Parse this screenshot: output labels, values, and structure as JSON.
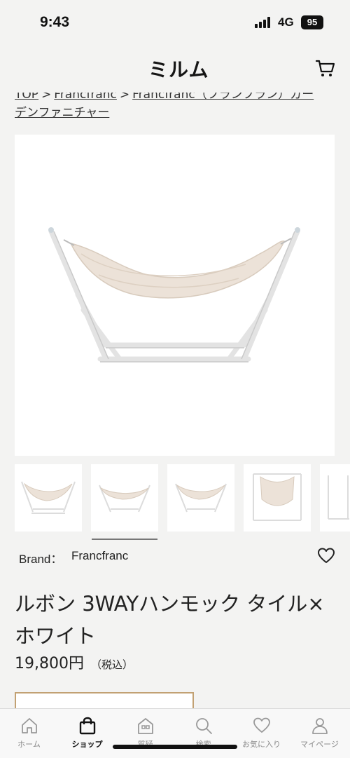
{
  "status": {
    "time": "9:43",
    "network": "4G",
    "battery": "95"
  },
  "header": {
    "logo": "ミルム",
    "cart_icon": "cart-icon"
  },
  "breadcrumb": {
    "items": [
      "TOP",
      "Francfranc",
      "Francfranc（フランフラン）ガーデンファニチャー"
    ],
    "line1": "Francfranc（フランフラン）ガー",
    "line2": "デンファニチャー"
  },
  "product": {
    "brand_label": "Brand：",
    "brand_name": "Francfranc",
    "title": "ルボン 3WAYハンモック タイル×ホワイト",
    "price": "19,800円",
    "tax": "（税込）"
  },
  "thumbnails": {
    "count_visible": 5,
    "selected_index": 1
  },
  "tabs": [
    {
      "label": "ホーム",
      "icon": "home-icon",
      "active": false
    },
    {
      "label": "ショップ",
      "icon": "shopping-bag-icon",
      "active": true
    },
    {
      "label": "質疑",
      "icon": "building-icon",
      "active": false
    },
    {
      "label": "検索",
      "icon": "search-icon",
      "active": false
    },
    {
      "label": "お気に入り",
      "icon": "heart-icon",
      "active": false
    },
    {
      "label": "マイページ",
      "icon": "user-icon",
      "active": false
    }
  ]
}
